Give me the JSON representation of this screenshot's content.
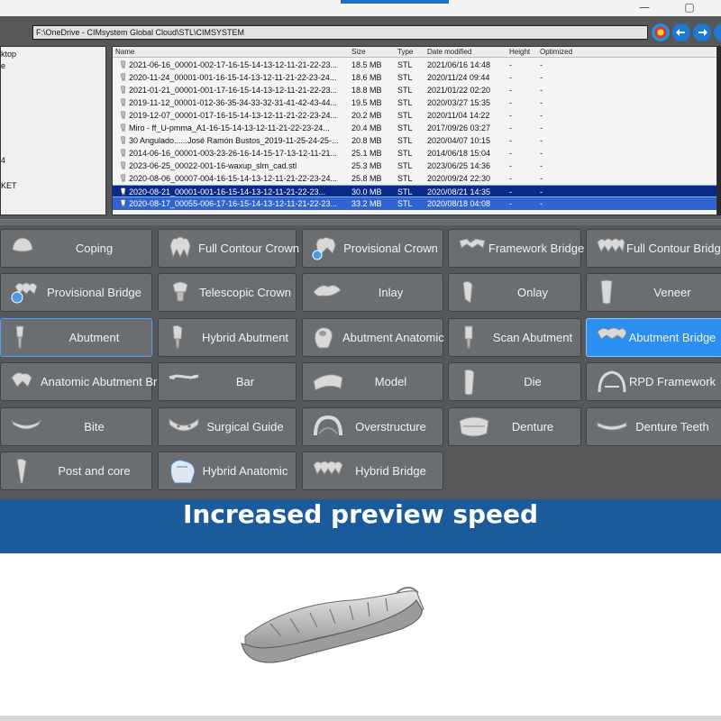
{
  "window": {
    "minimize_glyph": "—",
    "maximize_glyph": "▢",
    "accent_color": "#1e6fc8"
  },
  "path_bar": {
    "value": "F:\\OneDrive - CIMsystem Global Cloud\\STL\\CIMSYSTEM"
  },
  "nav_buttons": [
    "home-icon",
    "back-arrow-icon",
    "forward-arrow-icon",
    "extra-nav-icon"
  ],
  "tree": {
    "items": [
      "ktop",
      "e",
      "",
      "",
      "",
      "",
      "",
      "",
      "",
      "",
      "4",
      "",
      "",
      "KET"
    ]
  },
  "file_list": {
    "columns": [
      "Name",
      "Size",
      "Type",
      "Date modified",
      "Height",
      "Optimized"
    ],
    "rows": [
      {
        "name": "2021-06-16_00001-002-17-16-15-14-13-12-11-21-22-23...",
        "size": "18.5 MB",
        "type": "STL",
        "date": "2021/06/16 14:48",
        "height": "-",
        "optimized": "-"
      },
      {
        "name": "2020-11-24_00001-001-16-15-14-13-12-11-21-22-23-24...",
        "size": "18.6 MB",
        "type": "STL",
        "date": "2020/11/24 09:44",
        "height": "-",
        "optimized": "-"
      },
      {
        "name": "2021-01-21_00001-001-17-16-15-14-13-12-11-21-22-23...",
        "size": "18.8 MB",
        "type": "STL",
        "date": "2021/01/22 02:20",
        "height": "-",
        "optimized": "-"
      },
      {
        "name": "2019-11-12_00001-012-36-35-34-33-32-31-41-42-43-44...",
        "size": "19.5 MB",
        "type": "STL",
        "date": "2020/03/27 15:35",
        "height": "-",
        "optimized": "-"
      },
      {
        "name": "2019-12-07_00001-017-16-15-14-13-12-11-21-22-23-24...",
        "size": "20.2 MB",
        "type": "STL",
        "date": "2020/11/04 14:22",
        "height": "-",
        "optimized": "-"
      },
      {
        "name": "Miro  - ff_U-pmma_A1-16-15-14-13-12-11-21-22-23-24...",
        "size": "20.4 MB",
        "type": "STL",
        "date": "2017/09/26 03:27",
        "height": "-",
        "optimized": "-"
      },
      {
        "name": "30 Angulado......José Ramón Bustos_2019-11-25-24-25-...",
        "size": "20.8 MB",
        "type": "STL",
        "date": "2020/04/07 10:15",
        "height": "-",
        "optimized": "-"
      },
      {
        "name": "2014-06-16_00001-003-23-26-16-14-15-17-13-12-11-21...",
        "size": "25.1 MB",
        "type": "STL",
        "date": "2014/06/18 15:04",
        "height": "-",
        "optimized": "-"
      },
      {
        "name": "2023-06-25_00022-001-16-waxup_slm_cad.stl",
        "size": "25.3 MB",
        "type": "STL",
        "date": "2023/06/25 14:36",
        "height": "-",
        "optimized": "-"
      },
      {
        "name": "2020-08-06_00007-004-16-15-14-13-12-11-21-22-23-24...",
        "size": "25.8 MB",
        "type": "STL",
        "date": "2020/09/24 22:30",
        "height": "-",
        "optimized": "-"
      },
      {
        "name": "2020-08-21_00001-001-16-15-14-13-12-11-21-22-23...",
        "size": "30.0 MB",
        "type": "STL",
        "date": "2020/08/21 14:35",
        "height": "-",
        "optimized": "-"
      },
      {
        "name": "2020-08-17_00055-006-17-16-15-14-13-12-11-21-22-23...",
        "size": "33.2 MB",
        "type": "STL",
        "date": "2020/08/18 04:08",
        "height": "-",
        "optimized": "-"
      }
    ]
  },
  "categories": {
    "row1": [
      {
        "label": "Coping",
        "icon": "coping-icon"
      },
      {
        "label": "Full Contour Crown",
        "icon": "full-contour-crown-icon"
      },
      {
        "label": "Provisional Crown",
        "icon": "provisional-crown-icon"
      },
      {
        "label": "Framework Bridge",
        "icon": "framework-bridge-icon"
      },
      {
        "label": "Full Contour Bridge",
        "icon": "full-contour-bridge-icon"
      }
    ],
    "row2": [
      {
        "label": "Provisional Bridge",
        "icon": "provisional-bridge-icon"
      },
      {
        "label": "Telescopic Crown",
        "icon": "telescopic-crown-icon"
      },
      {
        "label": "Inlay",
        "icon": "inlay-icon"
      },
      {
        "label": "Onlay",
        "icon": "onlay-icon"
      },
      {
        "label": "Veneer",
        "icon": "veneer-icon"
      }
    ],
    "row3": [
      {
        "label": "Abutment",
        "icon": "abutment-icon"
      },
      {
        "label": "Hybrid Abutment",
        "icon": "hybrid-abutment-icon"
      },
      {
        "label": "Abutment Anatomic",
        "icon": "abutment-anatomic-icon"
      },
      {
        "label": "Scan Abutment",
        "icon": "scan-abutment-icon"
      },
      {
        "label": "Abutment Bridge",
        "icon": "abutment-bridge-icon"
      }
    ],
    "row4": [
      {
        "label": "Anatomic Abutment Bridge",
        "icon": "anatomic-abutment-bridge-icon"
      },
      {
        "label": "Bar",
        "icon": "bar-icon"
      },
      {
        "label": "Model",
        "icon": "model-icon"
      },
      {
        "label": "Die",
        "icon": "die-icon"
      },
      {
        "label": "RPD Framework",
        "icon": "rpd-framework-icon"
      }
    ],
    "row5": [
      {
        "label": "Bite",
        "icon": "bite-icon"
      },
      {
        "label": "Surgical Guide",
        "icon": "surgical-guide-icon"
      },
      {
        "label": "Overstructure",
        "icon": "overstructure-icon"
      },
      {
        "label": "Denture",
        "icon": "denture-icon"
      },
      {
        "label": "Denture Teeth",
        "icon": "denture-teeth-icon"
      }
    ],
    "row6": [
      {
        "label": "Post and core",
        "icon": "post-and-core-icon"
      },
      {
        "label": "Hybrid Anatomic",
        "icon": "hybrid-anatomic-icon"
      },
      {
        "label": "Hybrid Bridge",
        "icon": "hybrid-bridge-icon"
      }
    ],
    "active": "Abutment Bridge",
    "active_color": "#2a8ff0"
  },
  "banner": {
    "text": "Increased preview speed",
    "background": "#1b5b9b"
  },
  "preview": {
    "model_icon": "dental-arch-model-icon"
  }
}
